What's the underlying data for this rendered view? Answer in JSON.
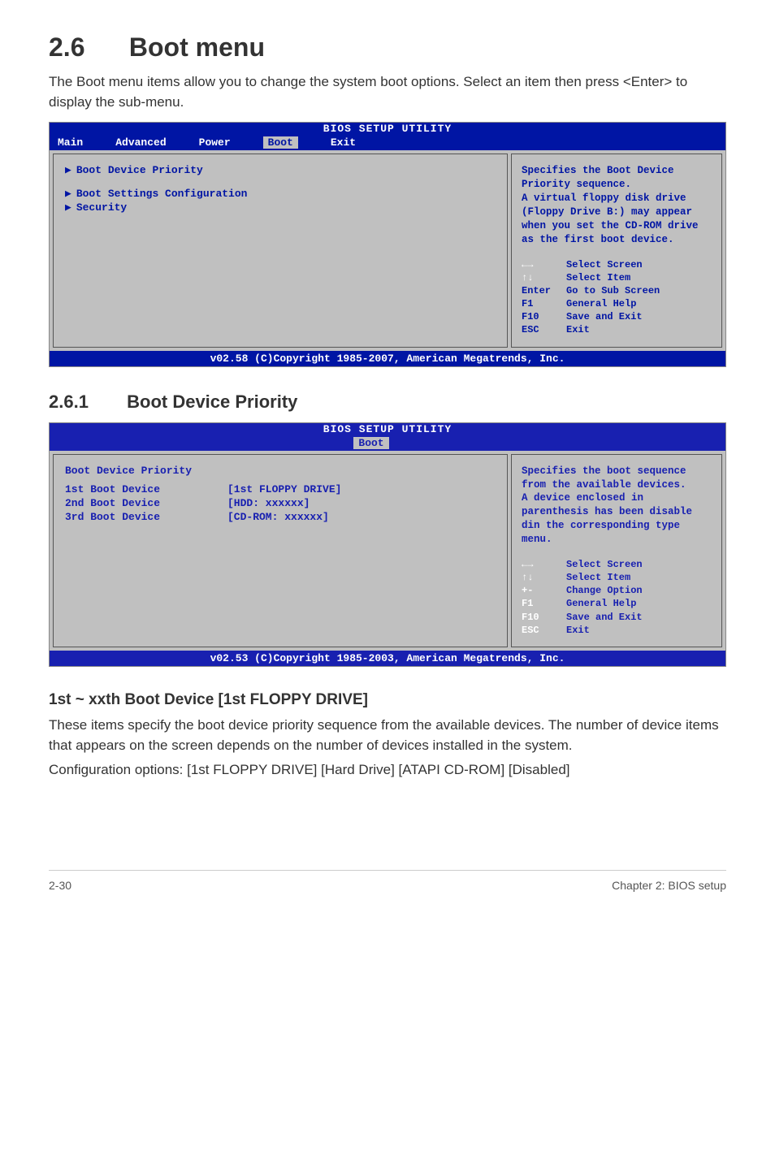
{
  "section": {
    "number": "2.6",
    "title": "Boot menu",
    "intro": "The Boot menu items allow you to change the system boot options. Select an item then press <Enter> to display the sub-menu."
  },
  "bios1": {
    "title": "BIOS SETUP UTILITY",
    "tabs": [
      "Main",
      "Advanced",
      "Power",
      "Boot",
      "Exit"
    ],
    "active_tab": "Boot",
    "left_items": [
      "Boot Device Priority",
      "Boot Settings Configuration",
      "Security"
    ],
    "help_top_lines": [
      "Specifies the Boot Device Priority sequence.",
      "",
      "A virtual floppy disk drive (Floppy Drive B:) may appear when you set the CD-ROM drive as the first boot device."
    ],
    "nav": [
      {
        "key": "←→",
        "txt": "Select Screen"
      },
      {
        "key": "↑↓",
        "txt": "Select Item"
      },
      {
        "key": "Enter",
        "txt": "Go to Sub Screen"
      },
      {
        "key": "F1",
        "txt": "General Help"
      },
      {
        "key": "F10",
        "txt": "Save and Exit"
      },
      {
        "key": "ESC",
        "txt": "Exit"
      }
    ],
    "footer": "v02.58 (C)Copyright 1985-2007, American Megatrends, Inc."
  },
  "subsection": {
    "number": "2.6.1",
    "title": "Boot Device Priority"
  },
  "bios2": {
    "title": "BIOS SETUP UTILITY",
    "active_tab": "Boot",
    "heading": "Boot Device Priority",
    "rows": [
      {
        "label": "1st Boot Device",
        "value": "[1st FLOPPY DRIVE]"
      },
      {
        "label": "2nd Boot Device",
        "value": "[HDD: xxxxxx]"
      },
      {
        "label": "3rd Boot Device",
        "value": "[CD-ROM: xxxxxx]"
      }
    ],
    "help_top_lines": [
      "Specifies the boot sequence from the available devices.",
      "",
      "A device enclosed in parenthesis has been disable din the corresponding type menu."
    ],
    "nav": [
      {
        "key": "←→",
        "txt": "Select Screen"
      },
      {
        "key": "↑↓",
        "txt": "Select Item"
      },
      {
        "key": "+-",
        "txt": "Change Option"
      },
      {
        "key": "F1",
        "txt": "General Help"
      },
      {
        "key": "F10",
        "txt": "Save and Exit"
      },
      {
        "key": "ESC",
        "txt": "Exit"
      }
    ],
    "footer": "v02.53 (C)Copyright 1985-2003, American Megatrends, Inc."
  },
  "body": {
    "h3": "1st ~ xxth Boot Device [1st FLOPPY DRIVE]",
    "p1": "These items specify the boot device priority sequence from the available devices. The number of device items that appears on the screen depends on the number of devices installed in the system.",
    "p2": "Configuration options: [1st FLOPPY DRIVE] [Hard Drive] [ATAPI CD-ROM] [Disabled]"
  },
  "footer": {
    "left": "2-30",
    "right": "Chapter 2: BIOS setup"
  }
}
